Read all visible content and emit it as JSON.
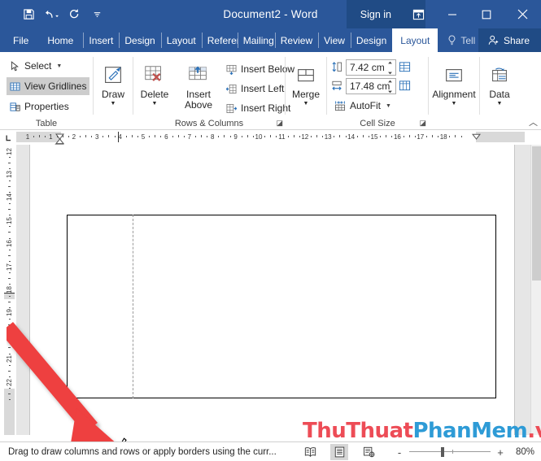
{
  "titlebar": {
    "document_title": "Document2  -  Word",
    "sign_in": "Sign in",
    "quick_access": [
      {
        "name": "save-icon",
        "label": "Save"
      },
      {
        "name": "undo-icon",
        "label": "Undo"
      },
      {
        "name": "redo-icon",
        "label": "Redo"
      },
      {
        "name": "customize-qat-icon",
        "label": "Customize Quick Access Toolbar"
      }
    ],
    "window_buttons": [
      {
        "name": "ribbon-display-options-icon",
        "label": "Ribbon Display Options"
      },
      {
        "name": "minimize-icon",
        "label": "Minimize"
      },
      {
        "name": "maximize-icon",
        "label": "Maximize"
      },
      {
        "name": "close-icon",
        "label": "Close"
      }
    ]
  },
  "tabs": [
    {
      "label": "File",
      "active": false
    },
    {
      "label": "Home",
      "active": false
    },
    {
      "label": "Insert",
      "active": false
    },
    {
      "label": "Design",
      "active": false
    },
    {
      "label": "Layout",
      "active": false
    },
    {
      "label": "Referer",
      "active": false
    },
    {
      "label": "Mailing",
      "active": false
    },
    {
      "label": "Review",
      "active": false
    },
    {
      "label": "View",
      "active": false
    },
    {
      "label": "Design",
      "active": false
    },
    {
      "label": "Layout",
      "active": true
    }
  ],
  "tell_me": "Tell me",
  "share": "Share",
  "ribbon": {
    "groups": [
      {
        "name": "table",
        "label": "Table"
      },
      {
        "name": "draw",
        "label": ""
      },
      {
        "name": "rows-columns",
        "label": "Rows & Columns"
      },
      {
        "name": "merge",
        "label": ""
      },
      {
        "name": "cell-size",
        "label": "Cell Size"
      },
      {
        "name": "alignment",
        "label": ""
      },
      {
        "name": "data",
        "label": ""
      }
    ],
    "table_group": {
      "select": "Select",
      "view_gridlines": "View Gridlines",
      "properties": "Properties"
    },
    "draw_group": {
      "draw": "Draw"
    },
    "rows_columns_group": {
      "delete": "Delete",
      "insert_above": "Insert\nAbove",
      "insert_above_line1": "Insert",
      "insert_above_line2": "Above",
      "insert_below": "Insert Below",
      "insert_left": "Insert Left",
      "insert_right": "Insert Right"
    },
    "merge_group": {
      "merge": "Merge"
    },
    "cell_size_group": {
      "height_value": "7.42 cm",
      "width_value": "17.48 cm",
      "autofit": "AutoFit",
      "label": "Cell Size"
    },
    "alignment_group": {
      "alignment": "Alignment"
    },
    "data_group": {
      "data": "Data"
    }
  },
  "rulers": {
    "horizontal_ticks": [
      "1",
      "1",
      "2",
      "3",
      "4",
      "5",
      "6",
      "7",
      "8",
      "9",
      "10",
      "11",
      "12",
      "13",
      "14",
      "15",
      "16",
      "17",
      "18"
    ],
    "vertical_ticks": [
      "12",
      "13",
      "14",
      "15",
      "16",
      "17",
      "18",
      "19",
      "20",
      "21",
      "22"
    ]
  },
  "watermark": {
    "part1": "ThuThuat",
    "part2": "PhanMem",
    "part3": ".vn"
  },
  "statusbar": {
    "message": "Drag to draw columns and rows or apply borders using the curr...",
    "views": [
      {
        "name": "read-mode-icon",
        "label": "Read Mode",
        "active": false
      },
      {
        "name": "print-layout-icon",
        "label": "Print Layout",
        "active": true
      },
      {
        "name": "web-layout-icon",
        "label": "Web Layout",
        "active": false
      }
    ],
    "zoom_out": "-",
    "zoom_in": "+",
    "zoom_level": "80%"
  },
  "colors": {
    "word_blue": "#2b579a",
    "word_blue_dark": "#204b85",
    "annotation_red": "#ee3f3f",
    "watermark_red": "#ed4c56",
    "watermark_blue": "#2e9bd6"
  }
}
